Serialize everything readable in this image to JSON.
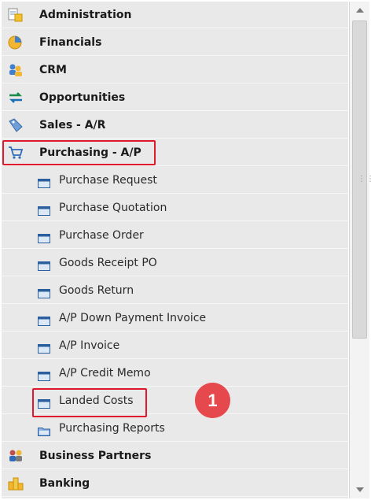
{
  "menu": {
    "modules": [
      {
        "label": "Administration",
        "icon": "administration-icon"
      },
      {
        "label": "Financials",
        "icon": "financials-icon"
      },
      {
        "label": "CRM",
        "icon": "crm-icon"
      },
      {
        "label": "Opportunities",
        "icon": "opportunities-icon"
      },
      {
        "label": "Sales - A/R",
        "icon": "sales-icon"
      },
      {
        "label": "Purchasing - A/P",
        "icon": "purchasing-cart-icon"
      }
    ],
    "purchasing_items": [
      {
        "label": "Purchase Request",
        "icon": "form-window-icon"
      },
      {
        "label": "Purchase Quotation",
        "icon": "form-window-icon"
      },
      {
        "label": "Purchase Order",
        "icon": "form-window-icon"
      },
      {
        "label": "Goods Receipt PO",
        "icon": "form-window-icon"
      },
      {
        "label": "Goods Return",
        "icon": "form-window-icon"
      },
      {
        "label": "A/P Down Payment Invoice",
        "icon": "form-window-icon"
      },
      {
        "label": "A/P Invoice",
        "icon": "form-window-icon"
      },
      {
        "label": "A/P Credit Memo",
        "icon": "form-window-icon"
      },
      {
        "label": "Landed Costs",
        "icon": "form-window-icon"
      },
      {
        "label": "Purchasing Reports",
        "icon": "reports-folder-icon"
      }
    ],
    "bottom_modules": [
      {
        "label": "Business Partners",
        "icon": "business-partners-icon"
      },
      {
        "label": "Banking",
        "icon": "banking-icon"
      }
    ]
  },
  "annotation": {
    "step_number": "1"
  },
  "colors": {
    "highlight": "#e0182d",
    "badge": "#e5484d",
    "menu_bg": "#e9e9e9"
  }
}
